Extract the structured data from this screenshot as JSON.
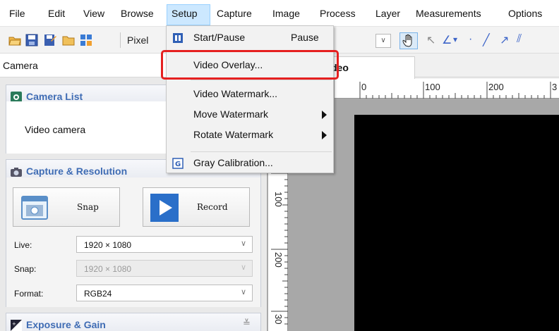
{
  "menubar": {
    "items": [
      "File",
      "Edit",
      "View",
      "Browse",
      "Setup",
      "Capture",
      "Image",
      "Process",
      "Layer",
      "Measurements",
      "Options"
    ]
  },
  "toolbar": {
    "unit": "Pixel",
    "zoom_suffix": "%",
    "combo_arrow": "∨"
  },
  "left_panel": {
    "header_title": "Camera",
    "camera_list": {
      "title": "Camera List",
      "camera_name": "Video camera"
    },
    "capture_resolution": {
      "title": "Capture & Resolution",
      "snap_label": "Snap",
      "record_label": "Record",
      "fields": [
        {
          "label": "Live:",
          "value": "1920 × 1080",
          "disabled": false
        },
        {
          "label": "Snap:",
          "value": "1920 × 1080",
          "disabled": true
        },
        {
          "label": "Format:",
          "value": "RGB24",
          "disabled": false
        }
      ]
    },
    "exposure_gain": {
      "title": "Exposure & Gain",
      "collapse_glyph": "≚"
    }
  },
  "document": {
    "tab_label": "deo",
    "hruler_ticks": [
      "0",
      "100",
      "200",
      "3"
    ],
    "vruler_ticks": [
      "100",
      "200",
      "30"
    ]
  },
  "setup_menu": {
    "items": [
      {
        "label": "Start/Pause",
        "shortcut": "Pause",
        "has_submenu": false
      },
      {
        "label": "Video Overlay...",
        "shortcut": "",
        "has_submenu": false
      },
      {
        "label": "Video Watermark...",
        "shortcut": "",
        "has_submenu": false
      },
      {
        "label": "Move Watermark",
        "shortcut": "",
        "has_submenu": true
      },
      {
        "label": "Rotate Watermark",
        "shortcut": "",
        "has_submenu": true
      },
      {
        "label": "Gray Calibration...",
        "shortcut": "",
        "has_submenu": false
      }
    ]
  },
  "colors": {
    "accent_blue": "#3f6cb4",
    "highlight_red": "#e52020",
    "menu_active": "#cce8ff"
  }
}
